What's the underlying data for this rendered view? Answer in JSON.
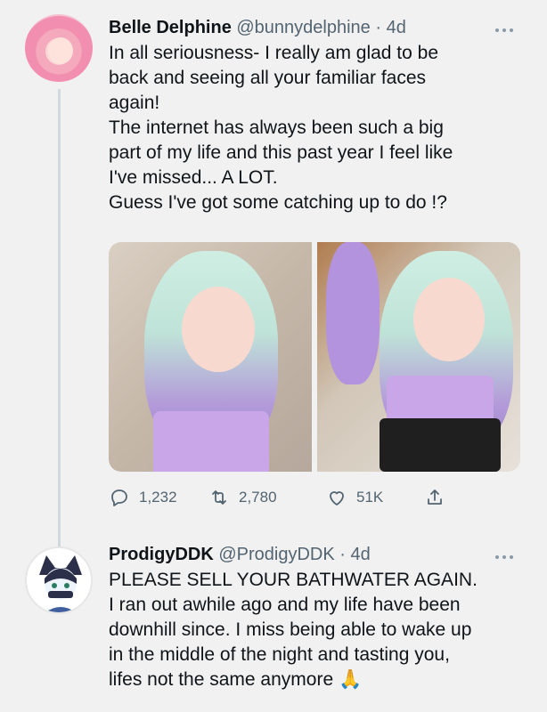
{
  "tweet1": {
    "name": "Belle Delphine",
    "handle": "@bunnydelphine",
    "dot": "·",
    "time": "4d",
    "lines": [
      "In all seriousness- I really am glad to be",
      "back and seeing all your familiar faces",
      "again!",
      "The internet has always been such a big",
      "part of my life and this past year I feel like",
      "I've missed... A LOT.",
      "Guess I've got some catching up to do !?"
    ],
    "replies": "1,232",
    "retweets": "2,780",
    "likes": "51K"
  },
  "tweet2": {
    "name": "ProdigyDDK",
    "handle": "@ProdigyDDK",
    "dot": "·",
    "time": "4d",
    "lines": [
      "PLEASE SELL YOUR BATHWATER AGAIN.",
      "I ran out awhile ago and my life have been",
      "downhill since. I miss being able to wake up",
      "in the middle of the night and tasting you,",
      "lifes not the same anymore 🙏"
    ]
  },
  "icons": {
    "more": "more-icon",
    "reply": "reply-icon",
    "retweet": "retweet-icon",
    "like": "heart-icon",
    "share": "share-icon"
  },
  "colors": {
    "background": "#f1f1f1",
    "text": "#0f1419",
    "secondary": "#536471",
    "thread_line": "#cfd9de"
  }
}
